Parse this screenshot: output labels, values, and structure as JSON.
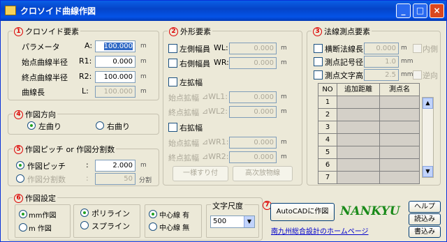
{
  "window": {
    "title": "クロソイド曲線作図",
    "minimize": "_",
    "maximize": "□",
    "close": "×"
  },
  "clothoid": {
    "num": "1",
    "title": "クロソイド要素",
    "rows": [
      {
        "label": "パラメータ",
        "key": "A:",
        "value": "100.000",
        "unit": "m"
      },
      {
        "label": "始点曲線半径",
        "key": "R1:",
        "value": "0.000",
        "unit": "m"
      },
      {
        "label": "終点曲線半径",
        "key": "R2:",
        "value": "100.000",
        "unit": "m"
      },
      {
        "label": "曲線長",
        "key": "L:",
        "value": "100.000",
        "unit": "m"
      }
    ]
  },
  "outer": {
    "num": "2",
    "title": "外形要素",
    "left_width": {
      "label": "左側幅員",
      "key": "WL:",
      "value": "0.000",
      "unit": "m"
    },
    "right_width": {
      "label": "右側幅員",
      "key": "WR:",
      "value": "0.000",
      "unit": "m"
    },
    "left_widen": "左拡幅",
    "left_rows": [
      {
        "label": "始点拡幅",
        "key": "⊿WL1:",
        "value": "0.000",
        "unit": "m"
      },
      {
        "label": "終点拡幅",
        "key": "⊿WL2:",
        "value": "0.000",
        "unit": "m"
      }
    ],
    "right_widen": "右拡幅",
    "right_rows": [
      {
        "label": "始点拡幅",
        "key": "⊿WR1:",
        "value": "0.000",
        "unit": "m"
      },
      {
        "label": "終点拡幅",
        "key": "⊿WR2:",
        "value": "0.000",
        "unit": "m"
      }
    ],
    "btn_linear": "一様すり付",
    "btn_parabola": "高次放物線"
  },
  "survey": {
    "num": "3",
    "title": "法線測点要素",
    "rows": [
      {
        "label": "横断法線長",
        "value": "0.000",
        "unit": "m",
        "extra": "内側"
      },
      {
        "label": "測点記号径",
        "value": "1.0",
        "unit": "mm",
        "extra": ""
      },
      {
        "label": "測点文字高",
        "value": "2.5",
        "unit": "mm",
        "extra": "逆向"
      }
    ],
    "headers": [
      "NO",
      "追加距離",
      "測点名"
    ],
    "row_nums": [
      "1",
      "2",
      "3",
      "4",
      "5",
      "6",
      "7"
    ],
    "scroll_up": "▲",
    "scroll_down": "▼"
  },
  "direction": {
    "num": "4",
    "title": "作図方向",
    "left": "左曲り",
    "right": "右曲り"
  },
  "pitch": {
    "num": "5",
    "title": "作図ピッチ or 作図分割数",
    "pitch_label": "作図ピッチ",
    "pitch_key": ":",
    "pitch_value": "2.000",
    "pitch_unit": "m",
    "div_label": "作図分割数",
    "div_key": ":",
    "div_value": "50",
    "div_unit": "分割"
  },
  "settings": {
    "num": "6",
    "title": "作図設定",
    "units": [
      "mm作図",
      "m 作図"
    ],
    "lines": [
      "ポリライン",
      "スプライン"
    ],
    "center": [
      "中心線 有",
      "中心線 無"
    ],
    "text_scale_label": "文字尺度",
    "text_scale_value": "500"
  },
  "actions": {
    "num": "7",
    "autocad": "AutoCADに作図",
    "logo": "NANKYU",
    "link": "南九州総合設計のホームページ",
    "help": "ヘルプ",
    "load": "読込み",
    "save": "書込み"
  }
}
